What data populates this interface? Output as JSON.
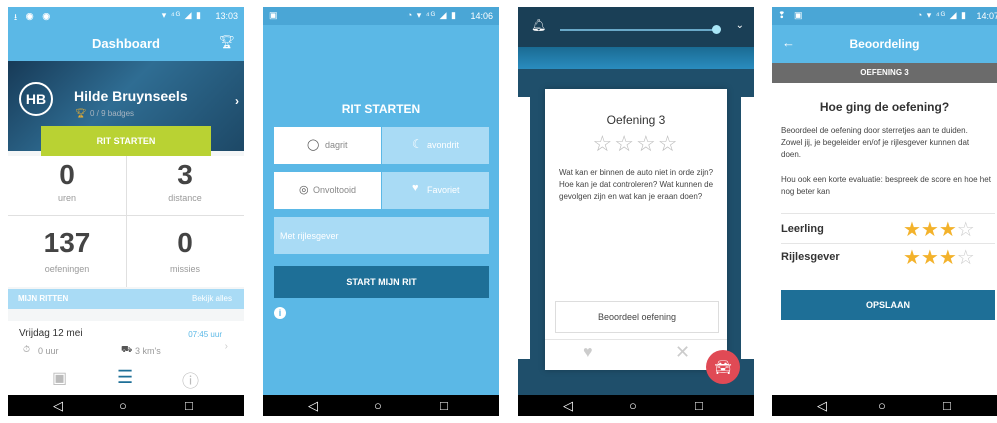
{
  "colors": {
    "sky_blue": "#5bb8e6",
    "light_blue": "#a9dbf5",
    "dark_blue": "#1e6f97",
    "lime": "#b9d233",
    "gold": "#f3b22b",
    "red": "#e04a55"
  },
  "screen1": {
    "status_time": "13:03",
    "title": "Dashboard",
    "profile_initials": "HB",
    "profile_name": "Hilde Bruynseels",
    "badges": "0 / 9 badges",
    "rit_starten": "RIT STARTEN",
    "stats": [
      {
        "value": "0",
        "label": "uren"
      },
      {
        "value": "3",
        "label": "distance"
      },
      {
        "value": "137",
        "label": "oefeningen"
      },
      {
        "value": "0",
        "label": "missies"
      }
    ],
    "mijn_ritten": "MIJN RITTEN",
    "bekijk_alles": "Bekijk alles",
    "ride": {
      "date": "Vrijdag 12 mei",
      "time": "07:45 uur",
      "duration": "0 uur",
      "distance": "3 km's"
    },
    "tab_icons": [
      "id-card-icon",
      "list-icon",
      "info-icon"
    ]
  },
  "screen2": {
    "status_time": "14:06",
    "title": "RIT STARTEN",
    "dagrit": "dagrit",
    "avondrit": "avondrit",
    "onvoltooid": "Onvoltooid",
    "favoriet": "Favoriet",
    "met_rijlesgever": "Met rijlesgever",
    "start_button": "START MIJN RIT",
    "selected_time_of_day": "dagrit",
    "selected_filter": "Onvoltooid"
  },
  "screen3": {
    "card_title": "Oefening 3",
    "rating": 0,
    "rating_max": 4,
    "question": "Wat kan er binnen de auto niet in orde zijn? Hoe kan je dat controleren? Wat kunnen de gevolgen zijn en wat kan je eraan doen?",
    "beoordeel_button": "Beoordeel oefening",
    "slider_value": 0.9
  },
  "screen4": {
    "status_time": "14:07",
    "title": "Beoordeling",
    "subtitle": "OEFENING 3",
    "heading": "Hoe ging de oefening?",
    "paragraph1": "Beoordeel de oefening door sterretjes aan te duiden. Zowel jij, je begeleider en/of je rijlesgever kunnen dat doen.",
    "paragraph2": "Hou ook een korte evaluatie: bespreek de score en hoe het nog beter kan",
    "ratings": [
      {
        "label": "Leerling",
        "stars": 3,
        "max": 4
      },
      {
        "label": "Rijlesgever",
        "stars": 3,
        "max": 4
      }
    ],
    "save_button": "OPSLAAN"
  }
}
